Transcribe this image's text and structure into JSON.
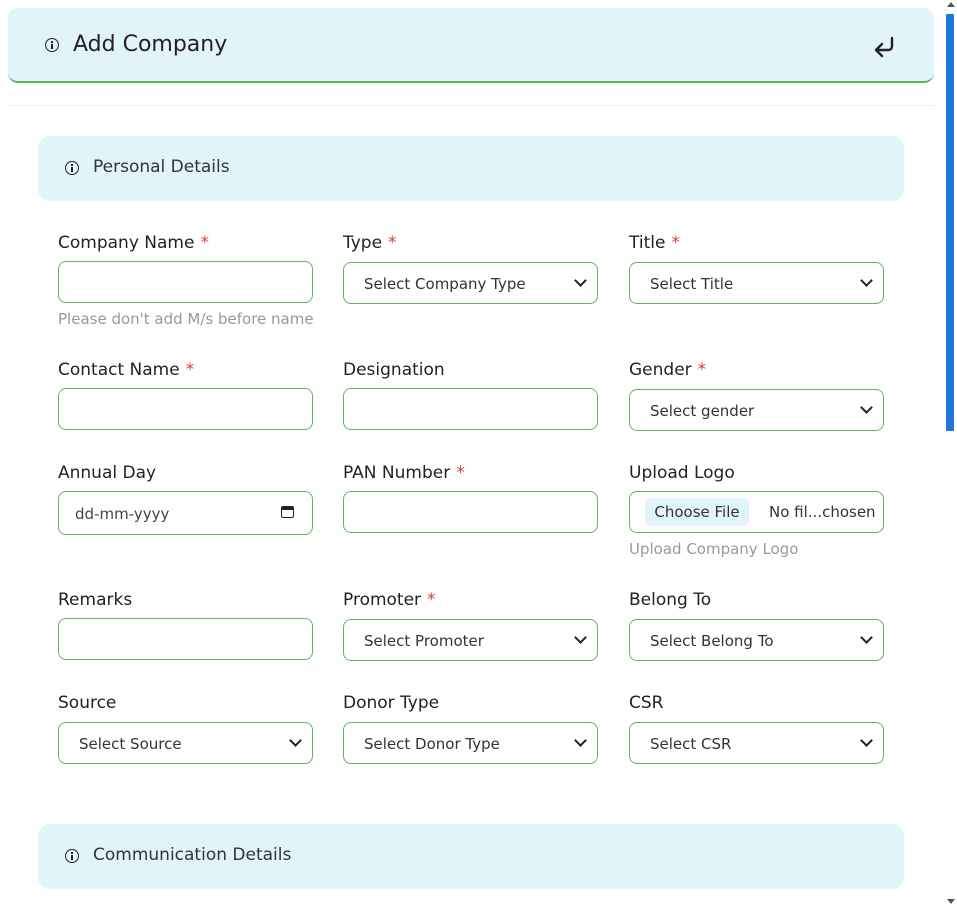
{
  "header": {
    "title": "Add Company",
    "info_icon": "info-icon",
    "back_icon": "return-arrow-icon"
  },
  "sections": {
    "personal": "Personal Details",
    "communication": "Communication Details"
  },
  "required_mark": "*",
  "fields": {
    "company_name": {
      "label": "Company Name",
      "value": "",
      "hint": "Please don't add M/s before name"
    },
    "type": {
      "label": "Type",
      "selected": "Select Company Type"
    },
    "title": {
      "label": "Title",
      "selected": "Select Title"
    },
    "contact_name": {
      "label": "Contact Name",
      "value": ""
    },
    "designation": {
      "label": "Designation",
      "value": ""
    },
    "gender": {
      "label": "Gender",
      "selected": "Select gender"
    },
    "annual_day": {
      "label": "Annual Day",
      "placeholder": "dd-mm-yyyy"
    },
    "pan_number": {
      "label": "PAN Number",
      "value": ""
    },
    "upload_logo": {
      "label": "Upload Logo",
      "button": "Choose File",
      "status": "No fil...chosen",
      "hint": "Upload Company Logo"
    },
    "remarks": {
      "label": "Remarks",
      "value": ""
    },
    "promoter": {
      "label": "Promoter",
      "selected": "Select Promoter"
    },
    "belong_to": {
      "label": "Belong To",
      "selected": "Select Belong To"
    },
    "source": {
      "label": "Source",
      "selected": "Select Source"
    },
    "donor_type": {
      "label": "Donor Type",
      "selected": "Select Donor Type"
    },
    "csr": {
      "label": "CSR",
      "selected": "Select CSR"
    }
  },
  "colors": {
    "header_bg": "#e1f4fa",
    "field_border": "#5cb85c",
    "required": "#e53935",
    "scrollbar_thumb": "#1e78d6"
  }
}
